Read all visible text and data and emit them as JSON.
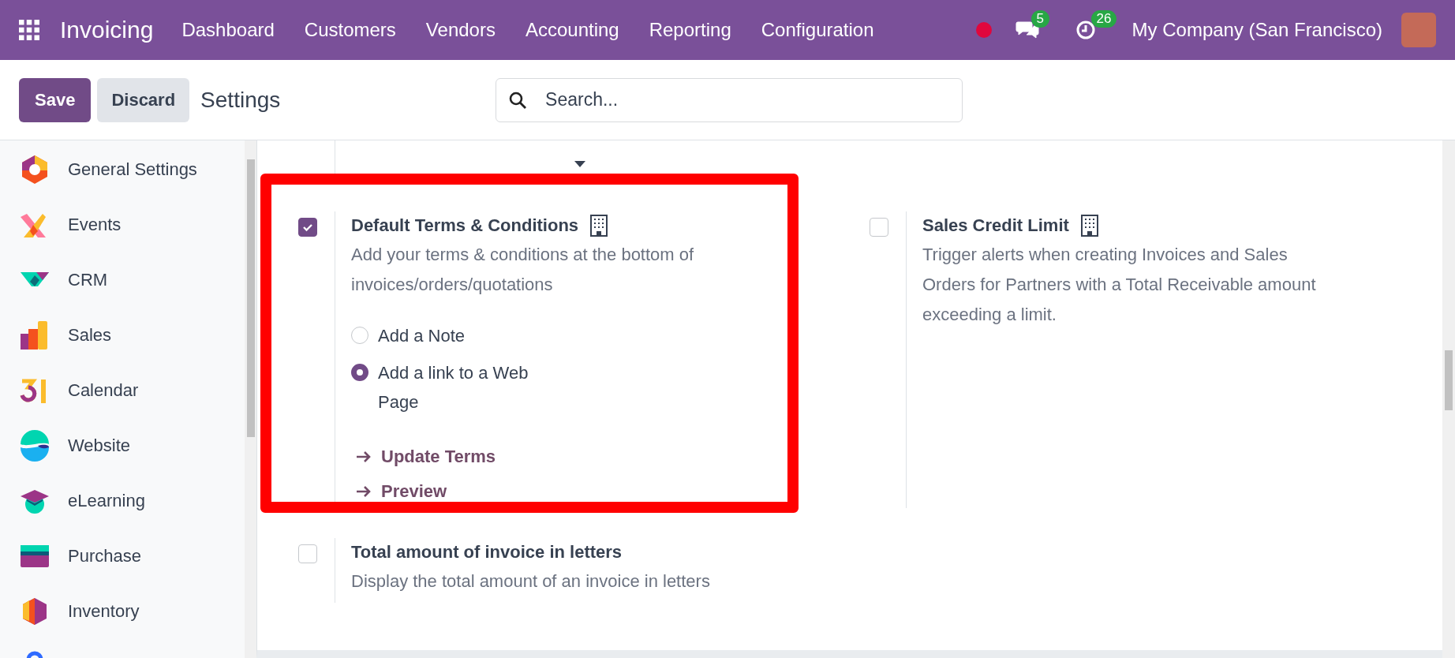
{
  "navbar": {
    "app_name": "Invoicing",
    "menu": [
      "Dashboard",
      "Customers",
      "Vendors",
      "Accounting",
      "Reporting",
      "Configuration"
    ],
    "chat_count": "5",
    "activity_count": "26",
    "company": "My Company (San Francisco)"
  },
  "control_panel": {
    "save": "Save",
    "discard": "Discard",
    "title": "Settings",
    "search": {
      "placeholder": "Search..."
    }
  },
  "sidebar": {
    "items": [
      {
        "label": "General Settings"
      },
      {
        "label": "Events"
      },
      {
        "label": "CRM"
      },
      {
        "label": "Sales"
      },
      {
        "label": "Calendar"
      },
      {
        "label": "Website"
      },
      {
        "label": "eLearning"
      },
      {
        "label": "Purchase"
      },
      {
        "label": "Inventory"
      }
    ]
  },
  "settings": [
    {
      "title": "Default Terms & Conditions",
      "company_specific": true,
      "checked": true,
      "description": "Add your terms & conditions at the bottom of invoices/orders/quotations",
      "options": [
        {
          "label": "Add a Note",
          "selected": false
        },
        {
          "label": "Add a link to a Web Page",
          "selected": true
        }
      ],
      "links": [
        "Update Terms",
        "Preview"
      ]
    },
    {
      "title": "Sales Credit Limit",
      "company_specific": true,
      "checked": false,
      "description": "Trigger alerts when creating Invoices and Sales Orders for Partners with a Total Receivable amount exceeding a limit."
    },
    {
      "title": "Total amount of invoice in letters",
      "company_specific": false,
      "checked": false,
      "description": "Display the total amount of an invoice in letters"
    }
  ]
}
